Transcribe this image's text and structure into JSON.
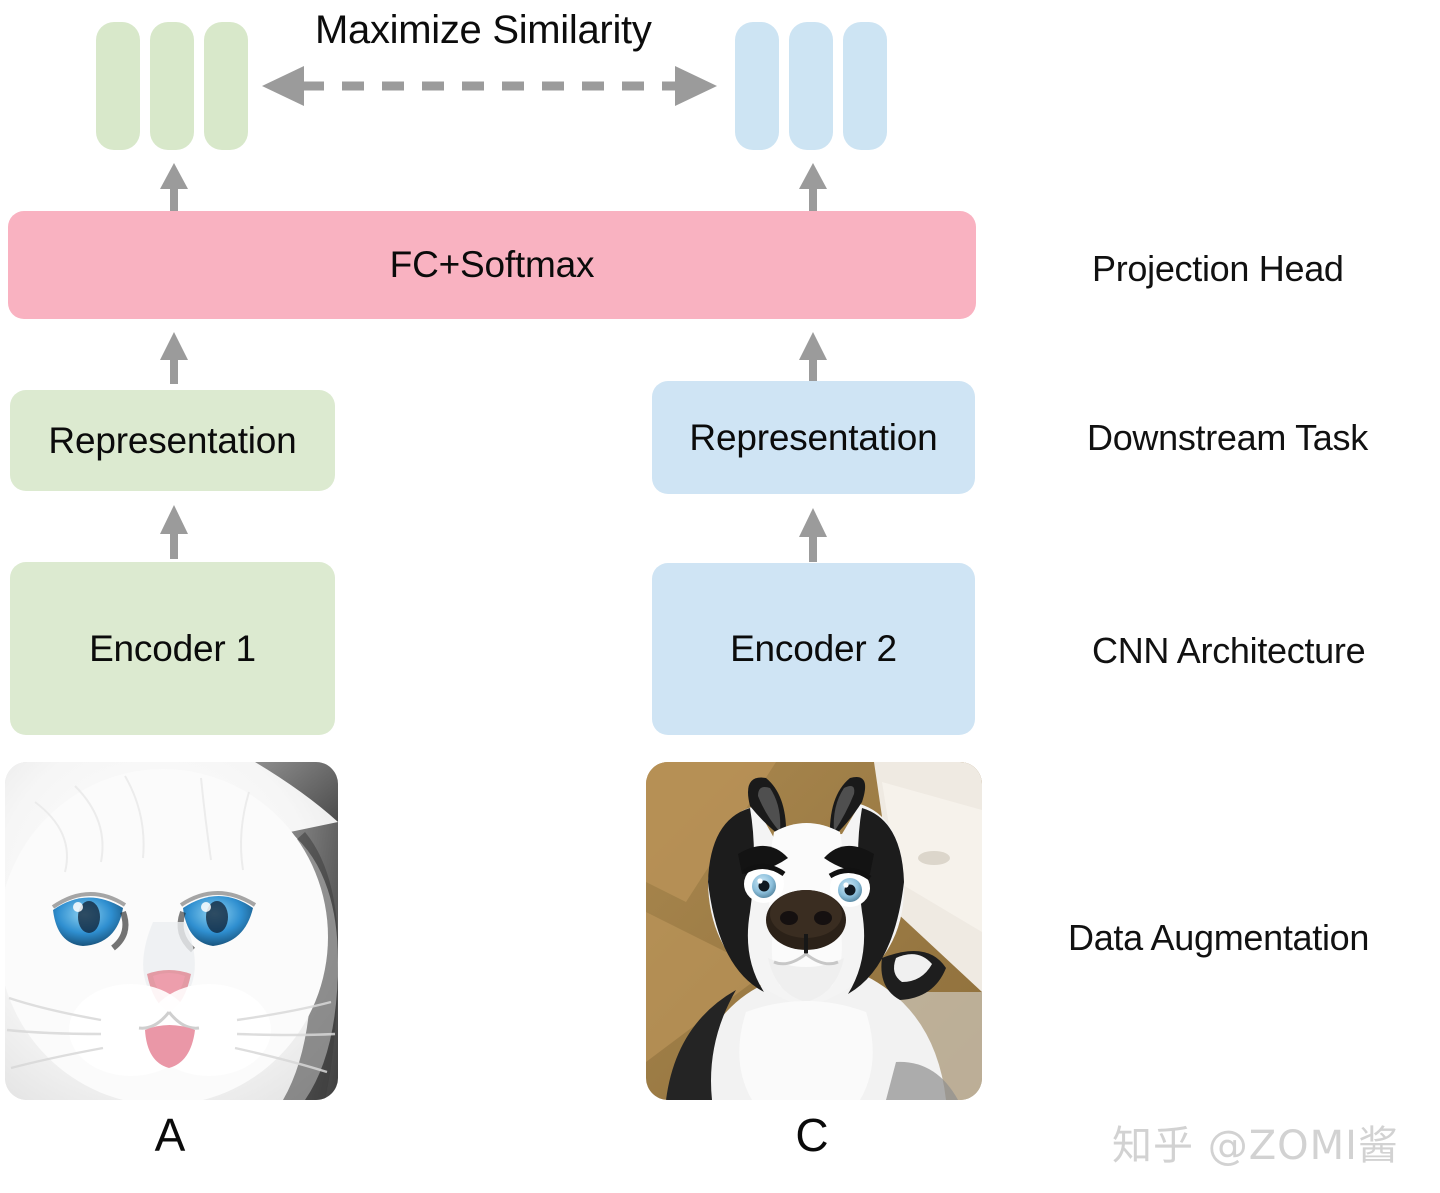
{
  "diagram": {
    "title_text": "Maximize Similarity",
    "branches": {
      "left": {
        "color": "#dcead0",
        "embedding_capsules": 3,
        "representation_label": "Representation",
        "encoder_label": "Encoder 1",
        "image_caption": "A",
        "image_subject": "white cat with blue eyes"
      },
      "right": {
        "color": "#cfe4f4",
        "embedding_capsules": 3,
        "representation_label": "Representation",
        "encoder_label": "Encoder 2",
        "image_caption": "C",
        "image_subject": "surprised husky dog"
      }
    },
    "shared_layer": {
      "label": "FC+Softmax",
      "color": "#f9b2c1"
    },
    "stage_labels": [
      {
        "text": "Projection Head"
      },
      {
        "text": "Downstream Task"
      },
      {
        "text": "CNN Architecture"
      },
      {
        "text": "Data Augmentation"
      }
    ],
    "arrows": {
      "similarity_arrow_style": "dashed double-headed",
      "flow_arrow_style": "solid up arrow",
      "arrow_color": "#9b9b9b"
    },
    "watermark": "知乎 @ZOMI酱"
  }
}
